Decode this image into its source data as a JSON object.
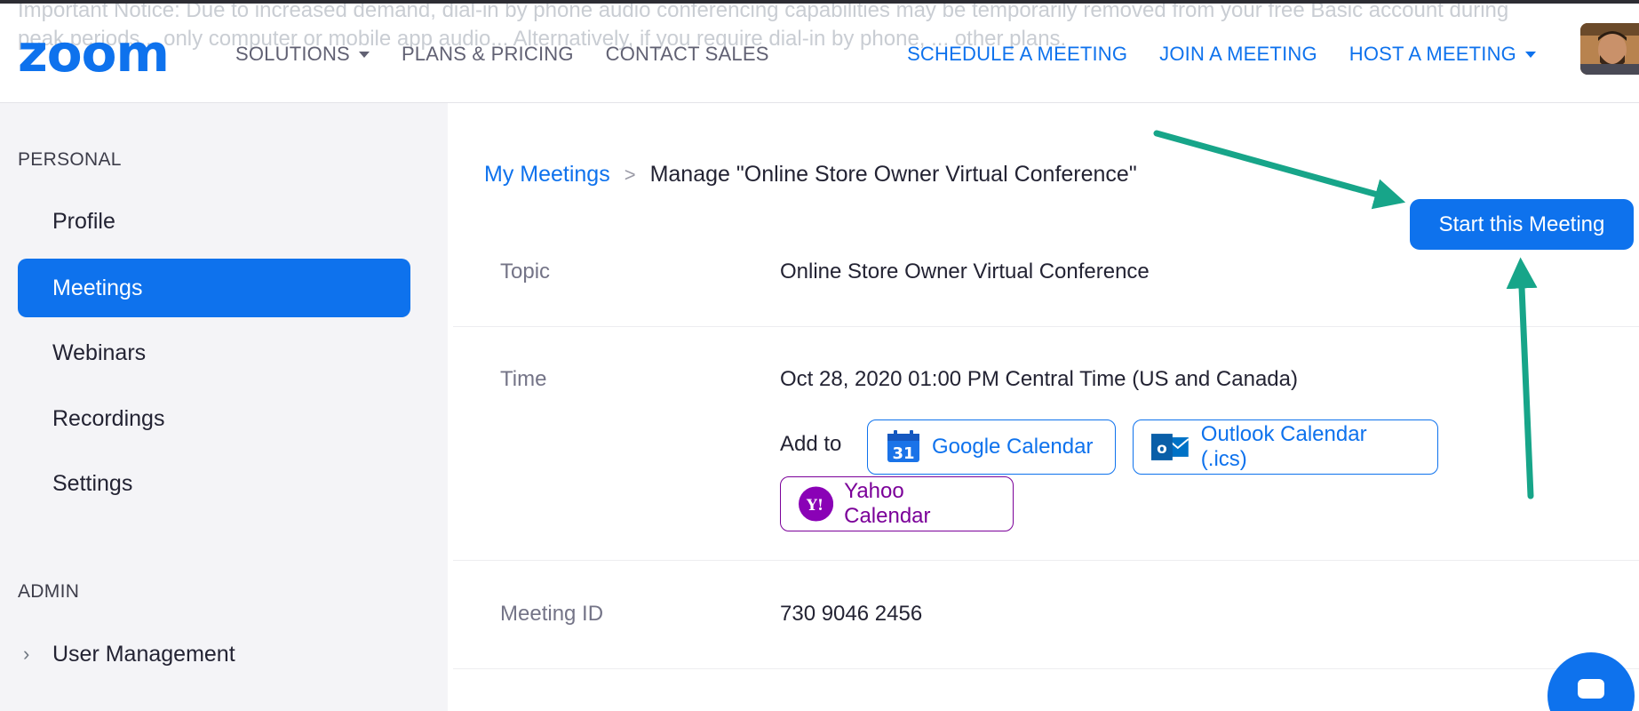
{
  "notice": {
    "line1": "Important Notice: Due to increased demand, dial-in by phone audio conferencing capabilities may be temporarily removed from your free Basic account during",
    "line2": "peak periods... only computer or mobile app audio... Alternatively, if you require dial-in by phone, ... other plans."
  },
  "header": {
    "logo_text": "zoom",
    "nav_left": [
      {
        "label": "SOLUTIONS",
        "has_caret": true
      },
      {
        "label": "PLANS & PRICING",
        "has_caret": false
      },
      {
        "label": "CONTACT SALES",
        "has_caret": false
      }
    ],
    "nav_right": [
      {
        "label": "SCHEDULE A MEETING"
      },
      {
        "label": "JOIN A MEETING"
      },
      {
        "label": "HOST A MEETING"
      }
    ]
  },
  "sidebar": {
    "personal_title": "PERSONAL",
    "items": [
      {
        "label": "Profile"
      },
      {
        "label": "Meetings"
      },
      {
        "label": "Webinars"
      },
      {
        "label": "Recordings"
      },
      {
        "label": "Settings"
      }
    ],
    "active": "Meetings",
    "admin_title": "ADMIN",
    "admin_items": [
      {
        "label": "User Management"
      }
    ]
  },
  "main": {
    "breadcrumb": {
      "link": "My Meetings",
      "separator": ">",
      "current": "Manage \"Online Store Owner Virtual Conference\""
    },
    "start_button": "Start this Meeting",
    "topic_label": "Topic",
    "topic_value": "Online Store Owner Virtual Conference",
    "time_label": "Time",
    "time_value": "Oct 28, 2020 01:00 PM Central Time (US and Canada)",
    "add_to_label": "Add to",
    "calendars": {
      "google": "Google Calendar",
      "google_icon_text": "31",
      "outlook": "Outlook Calendar (.ics)",
      "outlook_icon_text": "o",
      "yahoo": "Yahoo Calendar",
      "yahoo_icon_text": "Y!"
    },
    "meeting_id_label": "Meeting ID",
    "meeting_id_value": "730 9046 2456"
  },
  "colors": {
    "brand_blue": "#0e72ed",
    "arrow_green": "#17a589",
    "yahoo_purple": "#7b0099"
  }
}
